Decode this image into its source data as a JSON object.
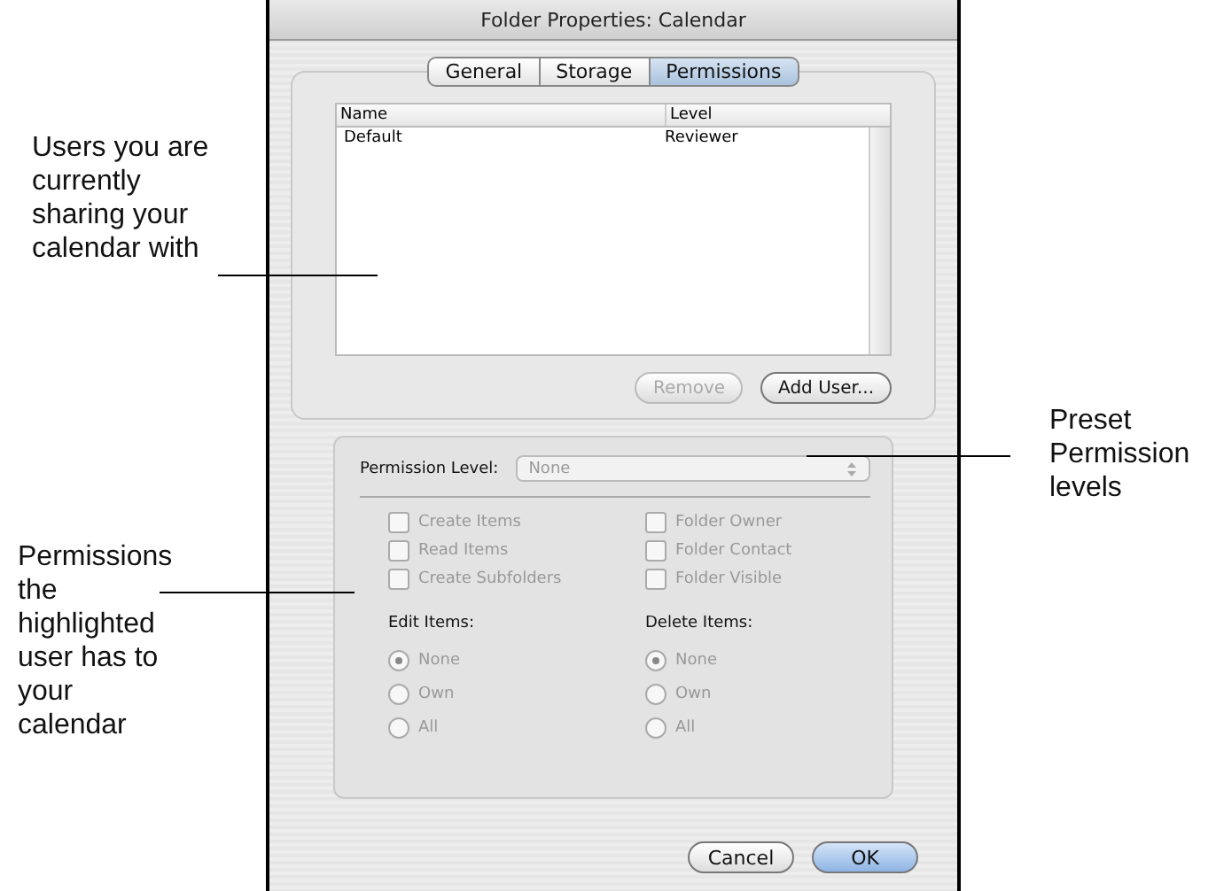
{
  "window": {
    "title": "Folder Properties: Calendar"
  },
  "tabs": [
    {
      "label": "General",
      "selected": false
    },
    {
      "label": "Storage",
      "selected": false
    },
    {
      "label": "Permissions",
      "selected": true
    }
  ],
  "table": {
    "columns": [
      "Name",
      "Level"
    ],
    "rows": [
      {
        "cells": [
          "Default",
          "Reviewer"
        ],
        "selected": false
      }
    ]
  },
  "list_buttons": [
    {
      "label": "Remove",
      "disabled": true
    },
    {
      "label": "Add User...",
      "disabled": false
    }
  ],
  "permissions": {
    "disabled": true,
    "permission_level": {
      "label": "Permission Level:",
      "value": "None"
    },
    "checkboxes": [
      {
        "label": "Create Items",
        "checked": false
      },
      {
        "label": "Folder Owner",
        "checked": false
      },
      {
        "label": "Read Items",
        "checked": false
      },
      {
        "label": "Folder Contact",
        "checked": false
      },
      {
        "label": "Create Subfolders",
        "checked": false
      },
      {
        "label": "Folder Visible",
        "checked": false
      }
    ],
    "radio_groups": [
      {
        "label": "Edit Items:",
        "options": [
          {
            "label": "None",
            "selected": true
          },
          {
            "label": "Own",
            "selected": false
          },
          {
            "label": "All",
            "selected": false
          }
        ]
      },
      {
        "label": "Delete Items:",
        "options": [
          {
            "label": "None",
            "selected": true
          },
          {
            "label": "Own",
            "selected": false
          },
          {
            "label": "All",
            "selected": false
          }
        ]
      }
    ]
  },
  "dialog_buttons": [
    {
      "label": "Cancel",
      "default": false
    },
    {
      "label": "OK",
      "default": true
    }
  ],
  "callouts": [
    {
      "text": "Users you are currently sharing your calendar with"
    },
    {
      "text": "Permissions the highlighted user has to your calendar"
    },
    {
      "text": "Preset Permission levels"
    }
  ]
}
